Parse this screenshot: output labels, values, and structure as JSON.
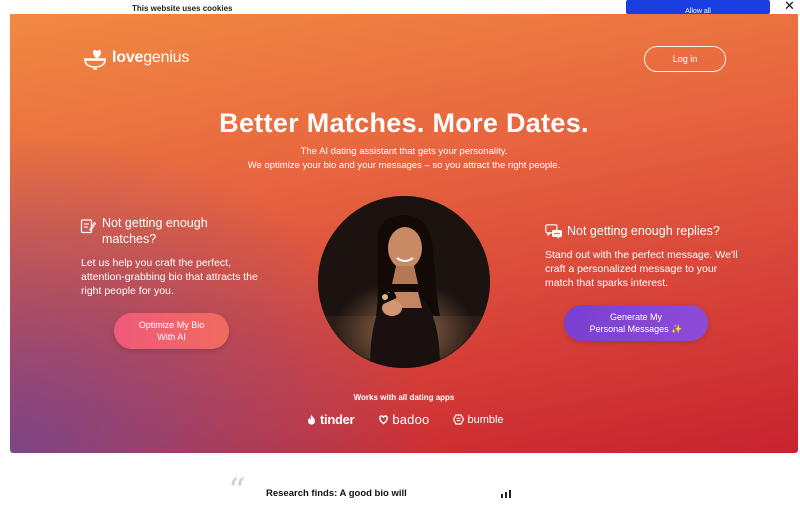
{
  "cookie": {
    "text": "This website uses cookies",
    "button_label": "Allow all"
  },
  "header": {
    "logo_text_bold": "love",
    "logo_text": "genius",
    "login_label": "Log in"
  },
  "hero": {
    "headline": "Better Matches. More Dates.",
    "subtitle_line1": "The AI dating assistant that gets your personality.",
    "subtitle_line2": "We optimize your bio and your messages – so you attract the right people."
  },
  "left_card": {
    "title": "Not getting enough matches?",
    "body": "Let us help you craft the perfect, attention-grabbing bio that attracts the right people for you.",
    "button_line1": "Optimize My Bio",
    "button_line2": "With AI",
    "icon": "edit-bio-icon"
  },
  "right_card": {
    "title": "Not getting enough replies?",
    "body": "Stand out with the perfect message. We'll craft a personalized message to your match that sparks interest.",
    "button_line1": "Generate My",
    "button_line2": "Personal Messages ✨",
    "icon": "chat-bubbles-icon"
  },
  "apps": {
    "heading": "Works with all dating apps",
    "items": [
      "tinder",
      "badoo",
      "bumble"
    ]
  },
  "below": {
    "research_text": "Research finds: A good bio will"
  },
  "colors": {
    "hero_top": "#f08a42",
    "hero_bottom": "#c8232f",
    "hero_purple": "#78468c",
    "left_button": "#f05a7a",
    "right_button": "#8e4bd8",
    "cookie_button": "#1a3fe0"
  }
}
